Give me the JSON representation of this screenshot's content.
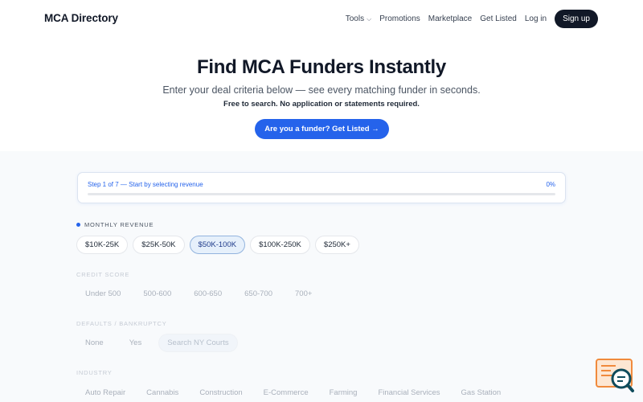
{
  "header": {
    "brand": "MCA Directory",
    "nav": [
      {
        "label": "Tools",
        "dropdown": true
      },
      {
        "label": "Promotions"
      },
      {
        "label": "Marketplace"
      },
      {
        "label": "Get Listed"
      },
      {
        "label": "Log in"
      }
    ],
    "signup_label": "Sign up"
  },
  "hero": {
    "title": "Find MCA Funders Instantly",
    "subtitle": "Enter your deal criteria below — see every matching funder in seconds.",
    "note": "Free to search. No application or statements required.",
    "cta_label": "Are you a funder? Get Listed →"
  },
  "progress": {
    "label": "Step 1 of 7 — Start by selecting revenue",
    "percent_text": "0%",
    "percent": 0
  },
  "sections": {
    "revenue": {
      "label": "Monthly Revenue",
      "options": [
        "$10K-25K",
        "$25K-50K",
        "$50K-100K",
        "$100K-250K",
        "$250K+"
      ],
      "selected": "$50K-100K"
    },
    "credit": {
      "label": "Credit Score",
      "options": [
        "Under 500",
        "500-600",
        "600-650",
        "650-700",
        "700+"
      ]
    },
    "defaults": {
      "label": "Defaults / Bankruptcy",
      "options": [
        "None",
        "Yes",
        "Search NY Courts"
      ]
    },
    "industry": {
      "label": "Industry",
      "options": [
        "Auto Repair",
        "Cannabis",
        "Construction",
        "E-Commerce",
        "Farming",
        "Financial Services",
        "Gas Station"
      ]
    }
  },
  "colors": {
    "accent": "#2563eb",
    "dark": "#111827",
    "selected_chip_bg": "#e6f0fb",
    "widget_orange": "#f08a3c",
    "widget_teal": "#0f4c5c"
  },
  "icons": {
    "tools_dropdown": "chevron-down-icon",
    "active_section": "dot-icon",
    "chat_widget": "chat-search-icon"
  }
}
